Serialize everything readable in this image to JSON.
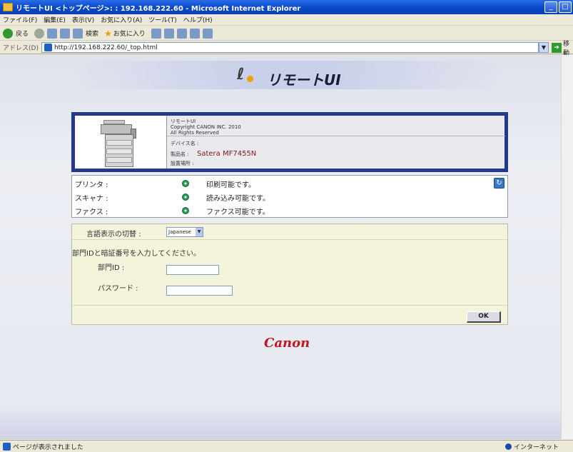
{
  "window": {
    "title": "リモートUI <トップページ>: : 192.168.222.60 - Microsoft Internet Explorer",
    "minimize_label": "_",
    "maximize_label": "□"
  },
  "menubar": {
    "items": [
      "ファイル(F)",
      "編集(E)",
      "表示(V)",
      "お気に入り(A)",
      "ツール(T)",
      "ヘルプ(H)"
    ]
  },
  "toolbar": {
    "back_label": "戻る",
    "search_label": "検索",
    "favorites_label": "お気に入り"
  },
  "address": {
    "label": "アドレス(D)",
    "url": "http://192.168.222.60/_top.html",
    "go_label": "移動"
  },
  "header": {
    "logo_text": "リモートUI"
  },
  "device": {
    "app_name": "リモートUI",
    "copyright": "Copyright CANON INC. 2010",
    "rights": "All Rights Reserved",
    "device_name_label": "デバイス名 :",
    "product_name_label": "製品名 :",
    "product_name": "Satera MF7455N",
    "location_label": "設置場所 :"
  },
  "status": {
    "rows": [
      {
        "label": "プリンタ :",
        "text": "印刷可能です。",
        "color": "#2a9a5a"
      },
      {
        "label": "スキャナ :",
        "text": "読み込み可能です。",
        "color": "#2a9a5a"
      },
      {
        "label": "ファクス :",
        "text": "ファクス可能です。",
        "color": "#2a9a5a"
      }
    ],
    "refresh_icon": "refresh-icon"
  },
  "login": {
    "language_label": "言語表示の切替 :",
    "language_value": "Japanese",
    "message": "部門IDと暗証番号を入力してください。",
    "dept_id_label": "部門ID :",
    "dept_id_value": "",
    "password_label": "パスワード :",
    "password_value": "",
    "ok_label": "OK"
  },
  "footer": {
    "brand": "Canon"
  },
  "statusbar": {
    "message": "ページが表示されました",
    "zone": "インターネット"
  },
  "colors": {
    "title_bar": "#0a49c9",
    "device_border": "#233a8c",
    "login_bg": "#f4f3dc",
    "canon_red": "#c0141e",
    "status_ok": "#2a9a5a"
  }
}
